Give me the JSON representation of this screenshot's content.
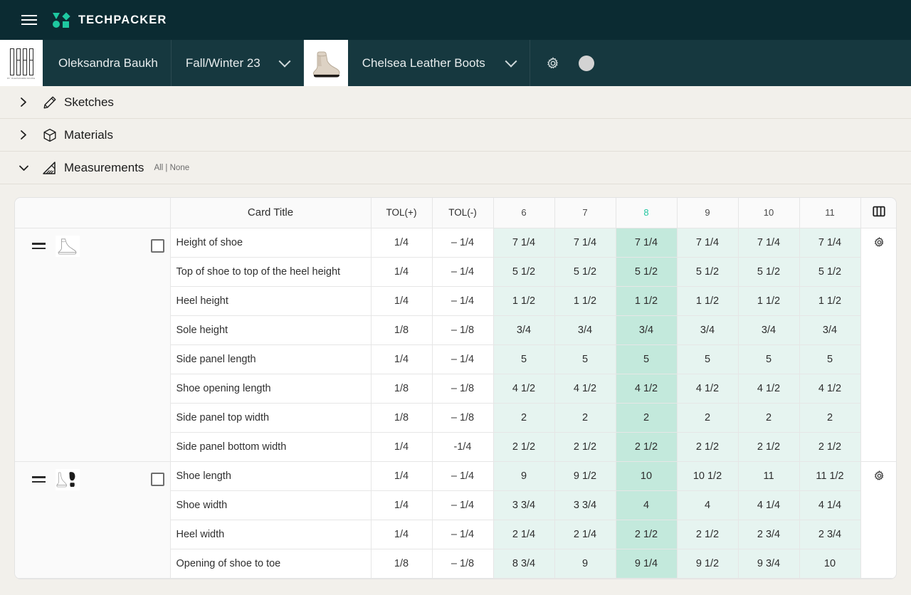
{
  "topbar": {
    "menu_icon": "hamburger-icon",
    "logo_icon": "techpacker-logo-icon",
    "brand": "TECHPACKER"
  },
  "projectbar": {
    "brand_tile_icon": "baukh-brand-logo",
    "brand_tile_caption": "BY OLEKSANDRA BAUKH",
    "user": "Oleksandra Baukh",
    "season": "Fall/Winter 23",
    "season_chevron": "chevron-down-icon",
    "style_thumb_icon": "chelsea-boot-thumbnail",
    "style": "Chelsea Leather Boots",
    "style_chevron": "chevron-down-icon",
    "settings_icon": "gear-icon",
    "avatar_icon": "user-avatar"
  },
  "sections": [
    {
      "label": "Sketches",
      "icon": "pencil-icon",
      "arrow": "chevron-right-icon",
      "expanded": false
    },
    {
      "label": "Materials",
      "icon": "cube-icon",
      "arrow": "chevron-right-icon",
      "expanded": false
    },
    {
      "label": "Measurements",
      "icon": "ruler-triangle-icon",
      "arrow": "chevron-down-icon",
      "expanded": true,
      "select_all": "All",
      "select_divider": "|",
      "select_none": "None"
    }
  ],
  "table": {
    "columns_toggle_icon": "columns-icon",
    "headers": {
      "card_title": "Card Title",
      "tol_plus": "TOL(+)",
      "tol_minus": "TOL(-)"
    },
    "sizes": [
      "6",
      "7",
      "8",
      "9",
      "10",
      "11"
    ],
    "sample_size": "8",
    "row_settings_icon": "gear-icon",
    "drag_handle_icon": "drag-handle-icon",
    "checkbox_icon": "checkbox-unchecked-icon",
    "groups": [
      {
        "thumb_icon": "boot-side-sketch-thumbnail",
        "checkbox_checked": false,
        "settings_icon": "gear-icon",
        "rows": [
          {
            "title": "Height of shoe",
            "tol_plus": "1/4",
            "tol_minus": "– 1/4",
            "values": [
              "7 1/4",
              "7 1/4",
              "7 1/4",
              "7 1/4",
              "7 1/4",
              "7 1/4"
            ]
          },
          {
            "title": "Top of shoe to top of the heel height",
            "tol_plus": "1/4",
            "tol_minus": "– 1/4",
            "values": [
              "5 1/2",
              "5 1/2",
              "5 1/2",
              "5 1/2",
              "5 1/2",
              "5 1/2"
            ]
          },
          {
            "title": "Heel height",
            "tol_plus": "1/4",
            "tol_minus": "– 1/4",
            "values": [
              "1 1/2",
              "1 1/2",
              "1 1/2",
              "1 1/2",
              "1 1/2",
              "1 1/2"
            ]
          },
          {
            "title": "Sole height",
            "tol_plus": "1/8",
            "tol_minus": "– 1/8",
            "values": [
              "3/4",
              "3/4",
              "3/4",
              "3/4",
              "3/4",
              "3/4"
            ]
          },
          {
            "title": "Side panel length",
            "tol_plus": "1/4",
            "tol_minus": "– 1/4",
            "values": [
              "5",
              "5",
              "5",
              "5",
              "5",
              "5"
            ]
          },
          {
            "title": "Shoe opening length",
            "tol_plus": "1/8",
            "tol_minus": "– 1/8",
            "values": [
              "4 1/2",
              "4 1/2",
              "4 1/2",
              "4 1/2",
              "4 1/2",
              "4 1/2"
            ]
          },
          {
            "title": "Side panel top width",
            "tol_plus": "1/8",
            "tol_minus": "– 1/8",
            "values": [
              "2",
              "2",
              "2",
              "2",
              "2",
              "2"
            ]
          },
          {
            "title": "Side panel bottom width",
            "tol_plus": "1/4",
            "tol_minus": "-1/4",
            "values": [
              "2 1/2",
              "2 1/2",
              "2 1/2",
              "2 1/2",
              "2 1/2",
              "2 1/2"
            ]
          }
        ]
      },
      {
        "thumb_icon": "boot-sole-sketch-thumbnail",
        "checkbox_checked": false,
        "settings_icon": "gear-icon",
        "rows": [
          {
            "title": "Shoe length",
            "tol_plus": "1/4",
            "tol_minus": "– 1/4",
            "values": [
              "9",
              "9 1/2",
              "10",
              "10 1/2",
              "11",
              "11 1/2"
            ]
          },
          {
            "title": "Shoe width",
            "tol_plus": "1/4",
            "tol_minus": "– 1/4",
            "values": [
              "3 3/4",
              "3 3/4",
              "4",
              "4",
              "4 1/4",
              "4 1/4"
            ]
          },
          {
            "title": "Heel width",
            "tol_plus": "1/4",
            "tol_minus": "– 1/4",
            "values": [
              "2 1/4",
              "2 1/4",
              "2 1/2",
              "2 1/2",
              "2 3/4",
              "2 3/4"
            ]
          },
          {
            "title": "Opening of shoe to toe",
            "tol_plus": "1/8",
            "tol_minus": "– 1/8",
            "values": [
              "8 3/4",
              "9",
              "9 1/4",
              "9 1/2",
              "9 3/4",
              "10"
            ]
          }
        ]
      }
    ]
  },
  "colors": {
    "topbar_bg": "#0b2b32",
    "projectbar_bg": "#16383f",
    "accent_teal": "#1ec8a0",
    "sample_col_bg": "#c3e9dc",
    "size_col_bg": "#e6f4f0",
    "page_bg": "#f2f0eb"
  }
}
